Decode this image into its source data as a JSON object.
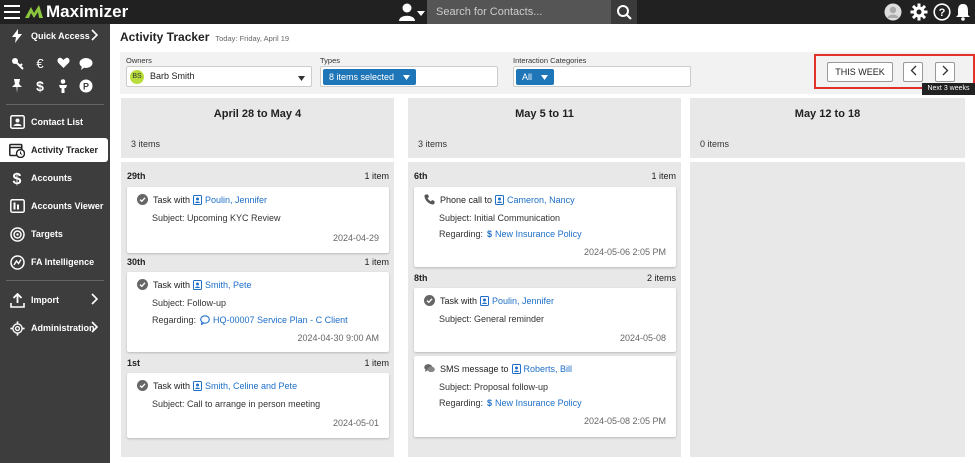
{
  "app": {
    "name": "Maximizer"
  },
  "topbar": {
    "search_placeholder": "Search for Contacts..."
  },
  "sidebar": {
    "quick_access": "Quick Access",
    "items": [
      {
        "label": "Contact List"
      },
      {
        "label": "Activity Tracker"
      },
      {
        "label": "Accounts"
      },
      {
        "label": "Accounts Viewer"
      },
      {
        "label": "Targets"
      },
      {
        "label": "FA Intelligence"
      },
      {
        "label": "Import"
      },
      {
        "label": "Administration"
      }
    ]
  },
  "page": {
    "title": "Activity Tracker",
    "subtitle": "Today: Friday, April 19"
  },
  "filters": {
    "owners_label": "Owners",
    "owner_initials": "BS",
    "owner_value": "Barb Smith",
    "types_label": "Types",
    "types_value": "8 items selected",
    "categories_label": "Interaction Categories",
    "categories_value": "All"
  },
  "nav": {
    "this_week": "THIS WEEK",
    "tooltip": "Next 3 weeks"
  },
  "columns": [
    {
      "title": "April 28 to May 4",
      "count": "3 items",
      "days": [
        {
          "day": "29th",
          "count": "1 item",
          "cards": [
            {
              "icon": "check-icon",
              "type": "Task with",
              "contact": "Poulin, Jennifer",
              "subject": "Subject: Upcoming KYC Review",
              "regarding_label": "",
              "regarding": "",
              "date": "2024-04-29"
            }
          ]
        },
        {
          "day": "30th",
          "count": "1 item",
          "cards": [
            {
              "icon": "check-icon",
              "type": "Task with",
              "contact": "Smith, Pete",
              "subject": "Subject: Follow-up",
              "regarding_label": "Regarding:",
              "regarding": "HQ-00007 Service Plan - C Client",
              "date": "2024-04-30 9:00 AM"
            }
          ]
        },
        {
          "day": "1st",
          "count": "1 item",
          "cards": [
            {
              "icon": "check-icon",
              "type": "Task with",
              "contact": "Smith, Celine and Pete",
              "subject": "Subject: Call to arrange in person meeting",
              "regarding_label": "",
              "regarding": "",
              "date": "2024-05-01"
            }
          ]
        }
      ]
    },
    {
      "title": "May 5 to 11",
      "count": "3 items",
      "days": [
        {
          "day": "6th",
          "count": "1 item",
          "cards": [
            {
              "icon": "phone-icon",
              "type": "Phone call to",
              "contact": "Cameron, Nancy",
              "subject": "Subject: Initial Communication",
              "regarding_label": "Regarding:",
              "regarding": "New Insurance Policy",
              "date": "2024-05-06 2:05 PM"
            }
          ]
        },
        {
          "day": "8th",
          "count": "2 items",
          "cards": [
            {
              "icon": "check-icon",
              "type": "Task with",
              "contact": "Poulin, Jennifer",
              "subject": "Subject: General reminder",
              "regarding_label": "",
              "regarding": "",
              "date": "2024-05-08"
            },
            {
              "icon": "sms-icon",
              "type": "SMS message to",
              "contact": "Roberts, Bill",
              "subject": "Subject: Proposal follow-up",
              "regarding_label": "Regarding:",
              "regarding": "New Insurance Policy",
              "date": "2024-05-08 2:05 PM"
            }
          ]
        }
      ]
    },
    {
      "title": "May 12 to 18",
      "count": "0 items",
      "days": []
    }
  ],
  "colors": {
    "accent": "#1e76b8",
    "link": "#1e6fc8",
    "highlight": "#e2312b",
    "sidebar": "#3d3d3d",
    "topbar": "#212121"
  }
}
